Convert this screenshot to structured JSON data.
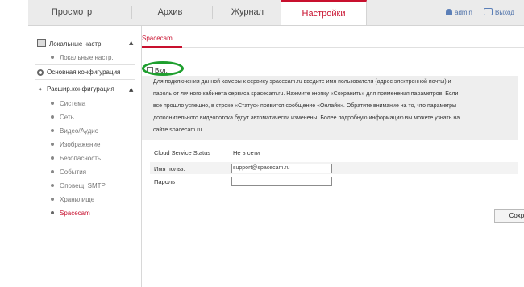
{
  "nav": {
    "tabs": [
      {
        "label": "Просмотр"
      },
      {
        "label": "Архив"
      },
      {
        "label": "Журнал"
      },
      {
        "label": "Настройки",
        "active": true
      }
    ],
    "user": "admin",
    "logout": "Выход"
  },
  "sidebar": {
    "local_header": "Локальные настр.",
    "local_sub": "Локальные настр.",
    "basic_header": "Основная конфигурация",
    "advanced_header": "Расшир.конфигурация",
    "advanced_items": [
      "Система",
      "Сеть",
      "Видео/Аудио",
      "Изображение",
      "Безопасность",
      "События",
      "Оповещ. SMTP",
      "Хранилище",
      "Spacecam"
    ],
    "active_item": "Spacecam"
  },
  "content": {
    "tab_label": "Spacecam",
    "enable_label": "Вкл.",
    "enable_checked": false,
    "info_lines": [
      "Для подключения данной камеры к сервису spacecam.ru введите имя пользователя (адрес электронной почты) и",
      "пароль от личного кабинета сервиса spacecam.ru. Нажмите кнопку «Сохранить» для применения параметров. Если",
      "все прошло успешно, в строке «Статус» появится сообщение «Онлайн». Обратите внимание на то, что параметры",
      "дополнительного видеопотока будут автоматически изменены. Более подробную информацию вы можете узнать на",
      "сайте spacecam.ru"
    ],
    "status_label": "Cloud Service Status",
    "status_value": "Не в сети",
    "username_label": "Имя польз.",
    "username_value": "support@spacecam.ru",
    "password_label": "Пароль",
    "password_value": "",
    "save_label": "Сохр."
  },
  "colors": {
    "accent": "#c8102e",
    "highlight_ring": "#1e9f2e"
  }
}
